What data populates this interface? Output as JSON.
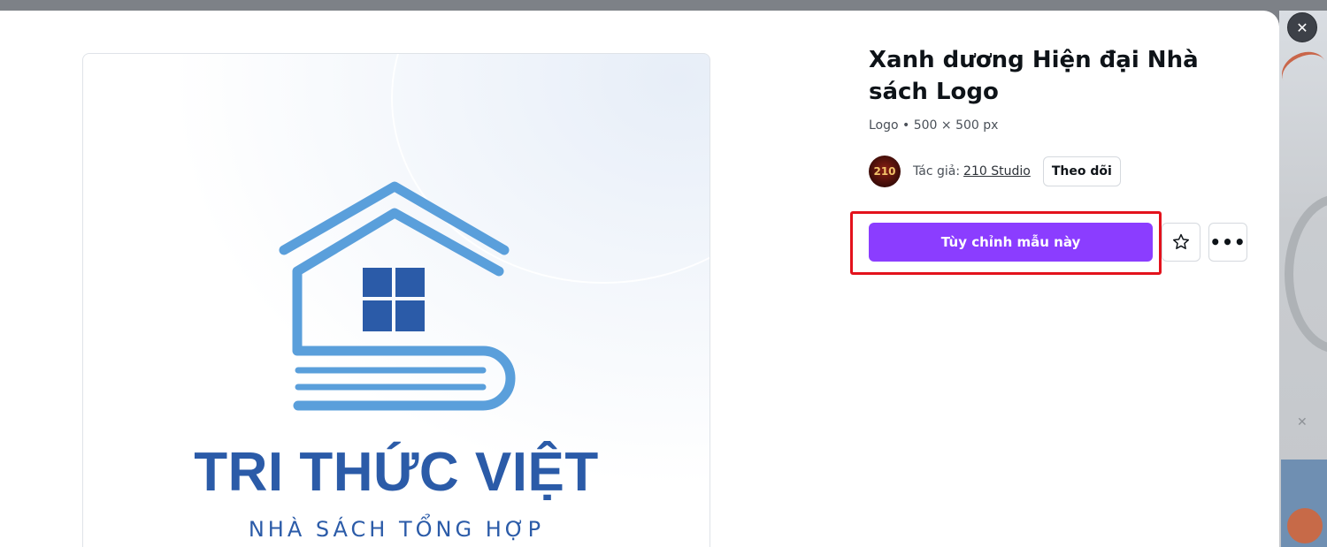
{
  "modal": {
    "close_icon": "close-icon",
    "close_glyph": "✕"
  },
  "template": {
    "title": "Xanh dương Hiện đại Nhà sách Logo",
    "meta": "Logo • 500 × 500 px",
    "author_label": "Tác giả:",
    "author_name": "210 Studio",
    "avatar_text": "210",
    "follow_label": "Theo dõi",
    "customize_label": "Tùy chỉnh mẫu này",
    "star_icon": "star-icon",
    "more_icon": "more-horizontal-icon",
    "more_glyph": "•••"
  },
  "preview": {
    "brand_name": "TRI THỨC VIỆT",
    "tagline": "NHÀ SÁCH TỔNG HỢP",
    "colors": {
      "roof_light": "#5a9fdb",
      "window_dark": "#2b5ba8",
      "text": "#2b5ba8"
    }
  },
  "colors": {
    "primary_button": "#8b3dff",
    "highlight_box": "#e3121c"
  }
}
